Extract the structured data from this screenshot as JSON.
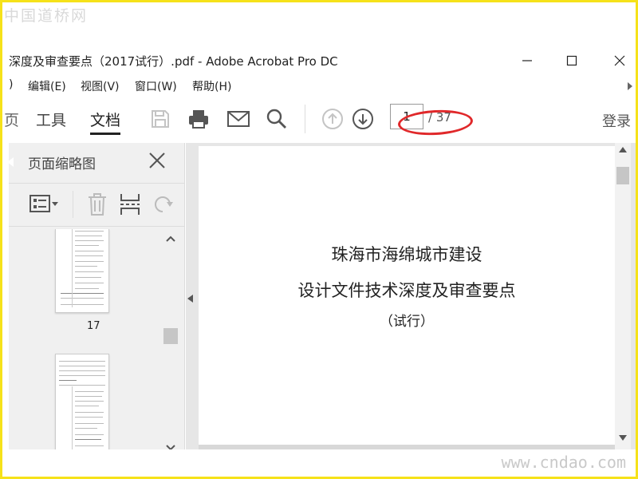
{
  "watermark_top": "中国道桥网",
  "watermark_bottom": "www.cndao.com",
  "window": {
    "title": "深度及审查要点（2017试行）.pdf - Adobe Acrobat Pro DC",
    "minimize_glyph": "—",
    "maximize_glyph": "☐",
    "close_glyph": "✕"
  },
  "menu": {
    "items": [
      ")",
      "编辑(E)",
      "视图(V)",
      "窗口(W)",
      "帮助(H)"
    ]
  },
  "toolbar": {
    "partial_tab": "页",
    "tab_tools": "工具",
    "tab_document": "文档",
    "current_page": "1",
    "total_pages": "/ 37",
    "login": "登录",
    "icons": [
      "save-icon",
      "print-icon",
      "email-icon",
      "search-icon",
      "page-up-icon",
      "page-down-icon"
    ]
  },
  "sidebar": {
    "title": "页面缩略图",
    "thumbnails": [
      {
        "page": "17"
      }
    ]
  },
  "document": {
    "line1": "珠海市海绵城市建设",
    "line2": "设计文件技术深度及审查要点",
    "line3": "（试行）"
  },
  "colors": {
    "frame_border": "#f6e21a",
    "annotation_ring": "#e0282a"
  }
}
